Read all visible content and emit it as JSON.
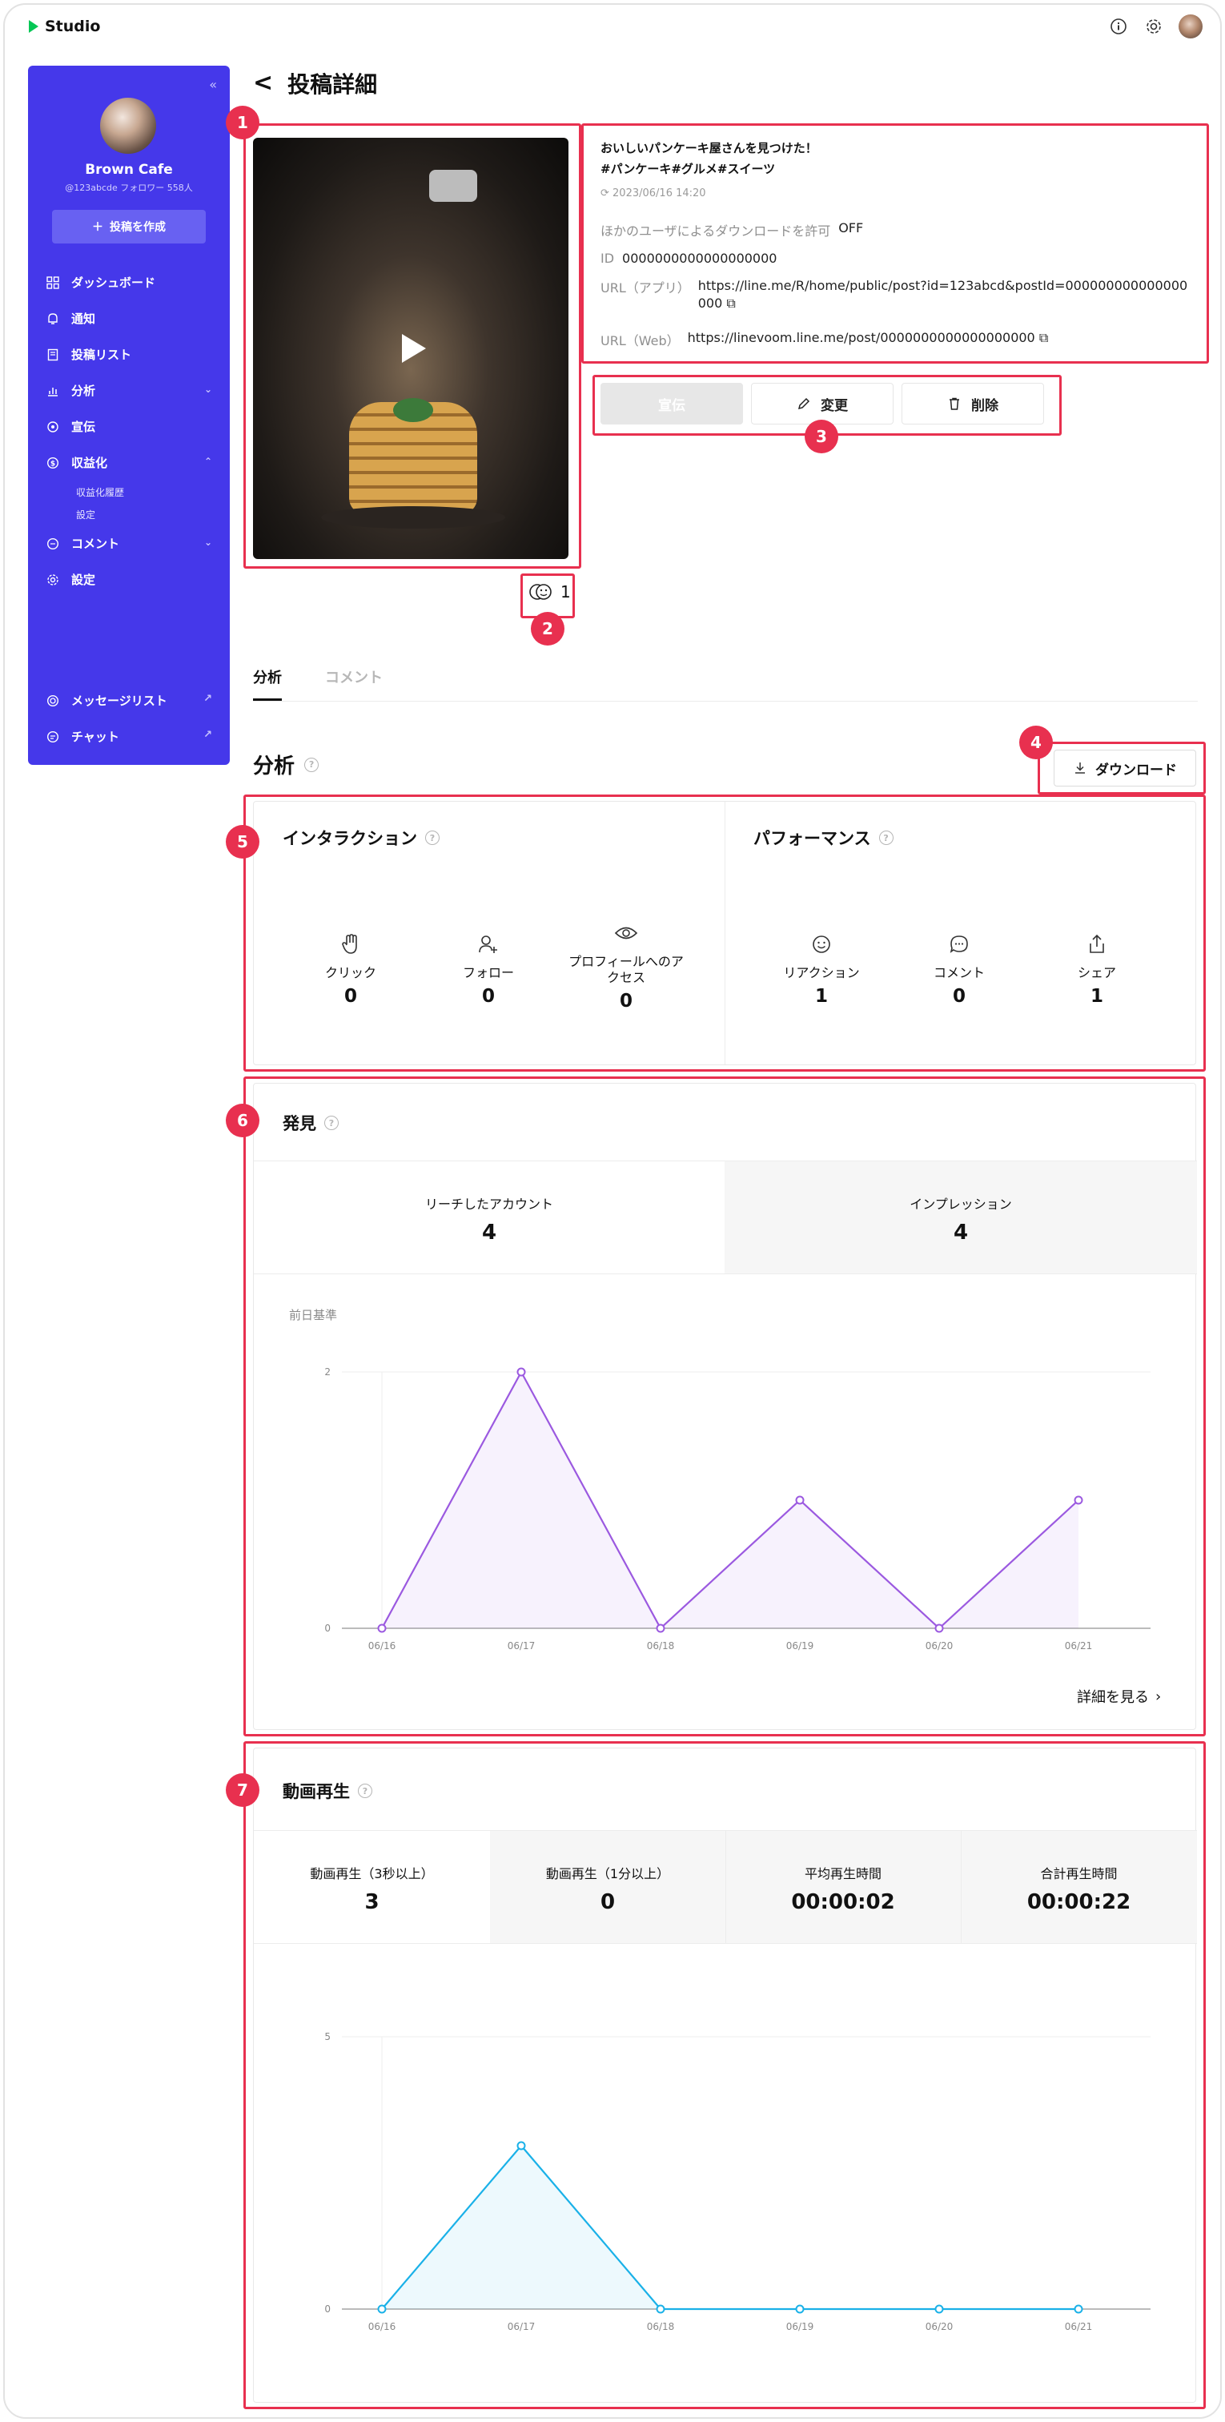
{
  "app": {
    "name": "Studio"
  },
  "topbar": {
    "icons": [
      "info-icon",
      "gear-icon",
      "user-avatar"
    ]
  },
  "sidebar": {
    "profile_name": "Brown Cafe",
    "profile_meta": "@123abcde  フォロワー 558人",
    "create_label": "投稿を作成",
    "items": [
      {
        "label": "ダッシュボード",
        "icon": "dashboard-icon"
      },
      {
        "label": "通知",
        "icon": "bell-icon"
      },
      {
        "label": "投稿リスト",
        "icon": "document-icon"
      },
      {
        "label": "分析",
        "icon": "chart-icon"
      },
      {
        "label": "宣伝",
        "icon": "megaphone-icon"
      },
      {
        "label": "収益化",
        "icon": "coin-icon"
      },
      {
        "label": "コメント",
        "icon": "comment-icon"
      },
      {
        "label": "設定",
        "icon": "gear-icon"
      }
    ],
    "sub_items": [
      "収益化履歴",
      "設定"
    ],
    "bottom_items": [
      {
        "label": "メッセージリスト",
        "icon": "target-icon"
      },
      {
        "label": "チャット",
        "icon": "chat-icon"
      }
    ]
  },
  "page": {
    "title": "投稿詳細"
  },
  "post": {
    "caption_line1": "おいしいパンケーキ屋さんを見つけた！",
    "caption_line2": "#パンケーキ#グルメ#スイーツ",
    "date": "2023/06/16 14:20",
    "download_label": "ほかのユーザによるダウンロードを許可",
    "download_value": "OFF",
    "id_label": "ID",
    "id_value": "0000000000000000000",
    "url_app_label": "URL（アプリ）",
    "url_app_value_1": "https://line.me/R/home/public/post?id=123abcd&postId=000000000000000",
    "url_app_value_2": "000",
    "url_web_label": "URL（Web）",
    "url_web_value": "https://linevoom.line.me/post/0000000000000000000",
    "reaction_count": "1"
  },
  "actions": {
    "promote": "宣伝",
    "edit": "変更",
    "delete": "削除"
  },
  "tabs": [
    {
      "label": "分析"
    },
    {
      "label": "コメント"
    }
  ],
  "analysis": {
    "title": "分析",
    "download_button": "ダウンロード"
  },
  "interaction": {
    "title": "インタラクション",
    "stats": [
      {
        "label": "クリック",
        "value": "0",
        "icon": "hand-icon"
      },
      {
        "label": "フォロー",
        "value": "0",
        "icon": "user-add-icon"
      },
      {
        "label": "プロフィールへのア\nクセス",
        "value": "0",
        "icon": "eye-icon"
      }
    ]
  },
  "performance": {
    "title": "パフォーマンス",
    "stats": [
      {
        "label": "リアクション",
        "value": "1",
        "icon": "smile-icon"
      },
      {
        "label": "コメント",
        "value": "0",
        "icon": "comment-icon"
      },
      {
        "label": "シェア",
        "value": "1",
        "icon": "share-icon"
      }
    ]
  },
  "discovery": {
    "title": "発見",
    "kpis": [
      {
        "label": "リーチしたアカウント",
        "value": "4"
      },
      {
        "label": "インプレッション",
        "value": "4"
      }
    ],
    "baseline": "前日基準",
    "more": "詳細を見る"
  },
  "video": {
    "title": "動画再生",
    "kpis": [
      {
        "label": "動画再生（3秒以上）",
        "value": "3"
      },
      {
        "label": "動画再生（1分以上）",
        "value": "0"
      },
      {
        "label": "平均再生時間",
        "value": "00:00:02"
      },
      {
        "label": "合計再生時間",
        "value": "00:00:22"
      }
    ]
  },
  "annotations": [
    "1",
    "2",
    "3",
    "4",
    "5",
    "6",
    "7"
  ],
  "colors": {
    "brand": "#4538ea",
    "annotation": "#e8304f",
    "line_purple": "#9b59e0",
    "line_blue": "#1ab1e8"
  },
  "chart_data": [
    {
      "type": "line",
      "x": [
        "06/16",
        "06/17",
        "06/18",
        "06/19",
        "06/20",
        "06/21"
      ],
      "series": [
        {
          "values": [
            0,
            2,
            0,
            1,
            0,
            1
          ]
        }
      ],
      "ylim": [
        0,
        2
      ],
      "yticks": [
        "0",
        "2"
      ],
      "color": "#9b59e0"
    },
    {
      "type": "line",
      "x": [
        "06/16",
        "06/17",
        "06/18",
        "06/19",
        "06/20",
        "06/21"
      ],
      "series": [
        {
          "values": [
            0,
            3,
            0,
            0,
            0,
            0
          ]
        }
      ],
      "ylim": [
        0,
        5
      ],
      "yticks": [
        "0",
        "5"
      ],
      "color": "#1ab1e8"
    }
  ]
}
